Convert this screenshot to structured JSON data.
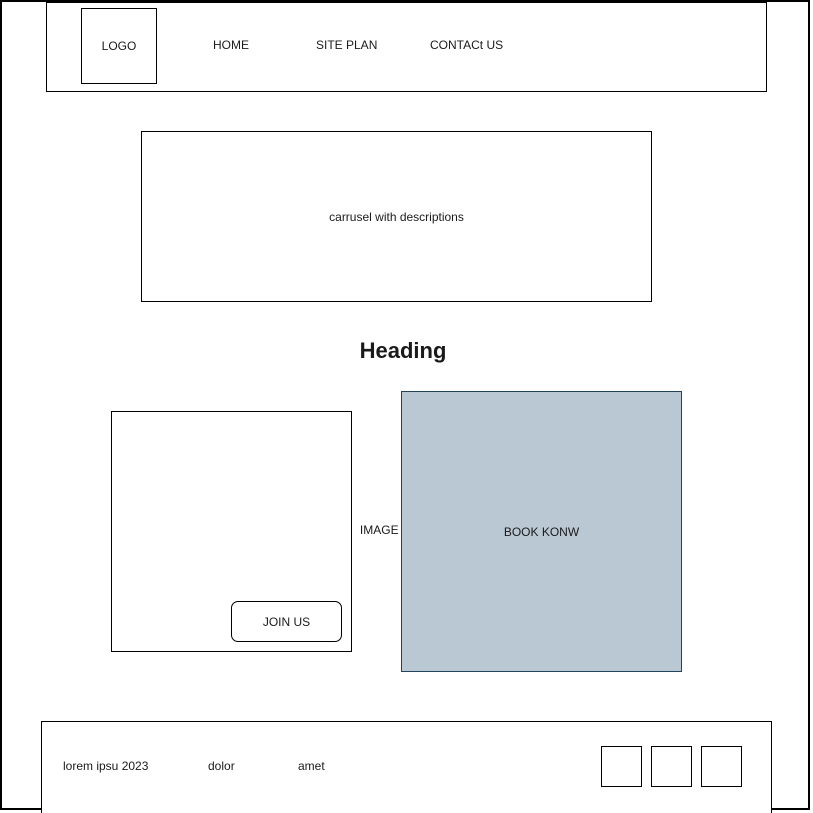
{
  "header": {
    "logo": "LOGO",
    "nav": [
      "HOME",
      "SITE PLAN",
      "CONTACt US"
    ]
  },
  "carousel": {
    "label": "carrusel with descriptions"
  },
  "main": {
    "heading": "Heading",
    "card": {
      "text": "IMAGE AND TEX",
      "button": "JOIN US"
    },
    "book": {
      "label": "BOOK KONW",
      "color": "#bac8d3"
    }
  },
  "footer": {
    "items": [
      "lorem ipsu 2023",
      "dolor",
      "amet"
    ]
  }
}
